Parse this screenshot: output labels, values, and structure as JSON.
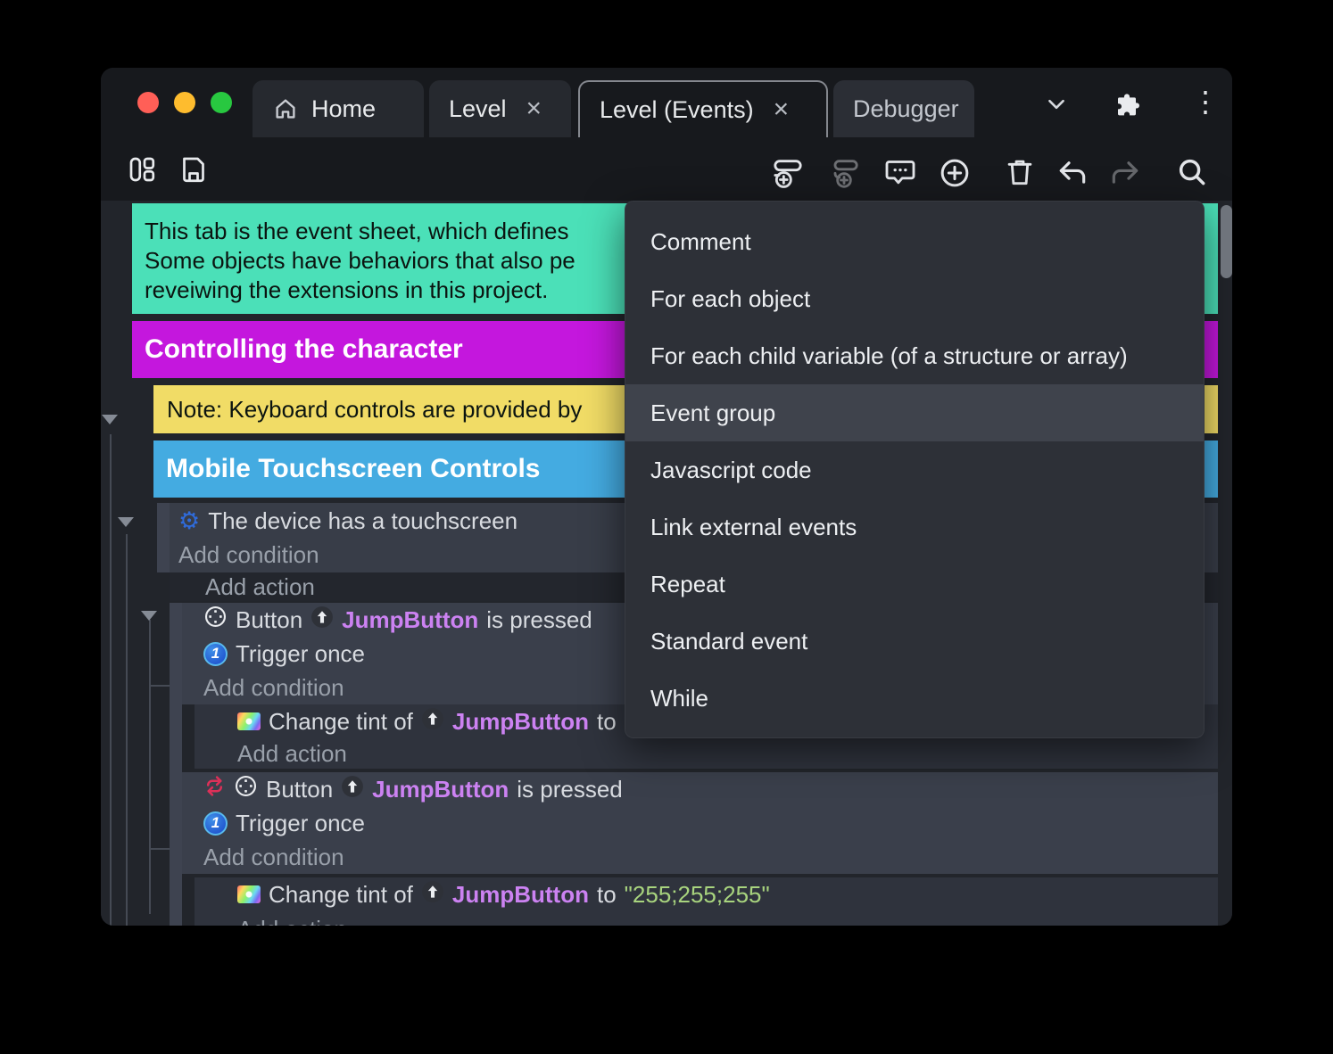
{
  "window": {
    "traffic_lights": [
      "close",
      "minimize",
      "fullscreen"
    ],
    "tabs": [
      {
        "label": "Home",
        "active": false
      },
      {
        "label": "Level",
        "active": false
      },
      {
        "label": "Level (Events)",
        "active": true
      },
      {
        "label": "Debugger",
        "active": false
      }
    ],
    "close_glyph": "×",
    "kebab_glyph": "⋮"
  },
  "toolbar": {
    "icons": [
      "layout-panels-icon",
      "save-icon",
      "play-icon",
      "play-dropdown-caret-icon",
      "globe-preview-icon",
      "add-event-icon",
      "add-sub-event-icon",
      "add-comment-icon",
      "add-action-circle-icon",
      "delete-icon",
      "undo-icon",
      "redo-icon",
      "search-icon"
    ],
    "accent_button_color": "#5b2ee1"
  },
  "menu": {
    "items": [
      "Comment",
      "For each object",
      "For each child variable (of a structure or array)",
      "Event group",
      "Javascript code",
      "Link external events",
      "Repeat",
      "Standard event",
      "While"
    ],
    "highlighted": "Event group"
  },
  "sheet": {
    "comment_top_lines": [
      "This tab is the event sheet, which defines",
      "Some objects have behaviors that also pe",
      "reveiwing the extensions in this project."
    ],
    "group_controlling": "Controlling the character",
    "note_keyboard": "Note: Keyboard controls are provided by",
    "group_mobile": "Mobile Touchscreen Controls",
    "device_condition": "The device has a touchscreen",
    "add_condition": "Add condition",
    "add_action": "Add action",
    "button_object": "Button",
    "jump_button": "JumpButton",
    "is_pressed": "is pressed",
    "trigger_once": "Trigger once",
    "trigger_glyph": "1",
    "change_tint_prefix": "Change tint of",
    "to_word": "to",
    "tint_value": "\"255;255;255\""
  },
  "colors": {
    "comment_teal": "#4be0b8",
    "group_magenta": "#c417dd",
    "note_yellow": "#f1dc66",
    "group_blue": "#44abe1",
    "instance_violet": "#cc82f2",
    "string_green": "#a8d47e",
    "accent_purple": "#5b2ee1",
    "traffic_red": "#ff5f57",
    "traffic_yellow": "#febc2e",
    "traffic_green": "#28c840"
  }
}
